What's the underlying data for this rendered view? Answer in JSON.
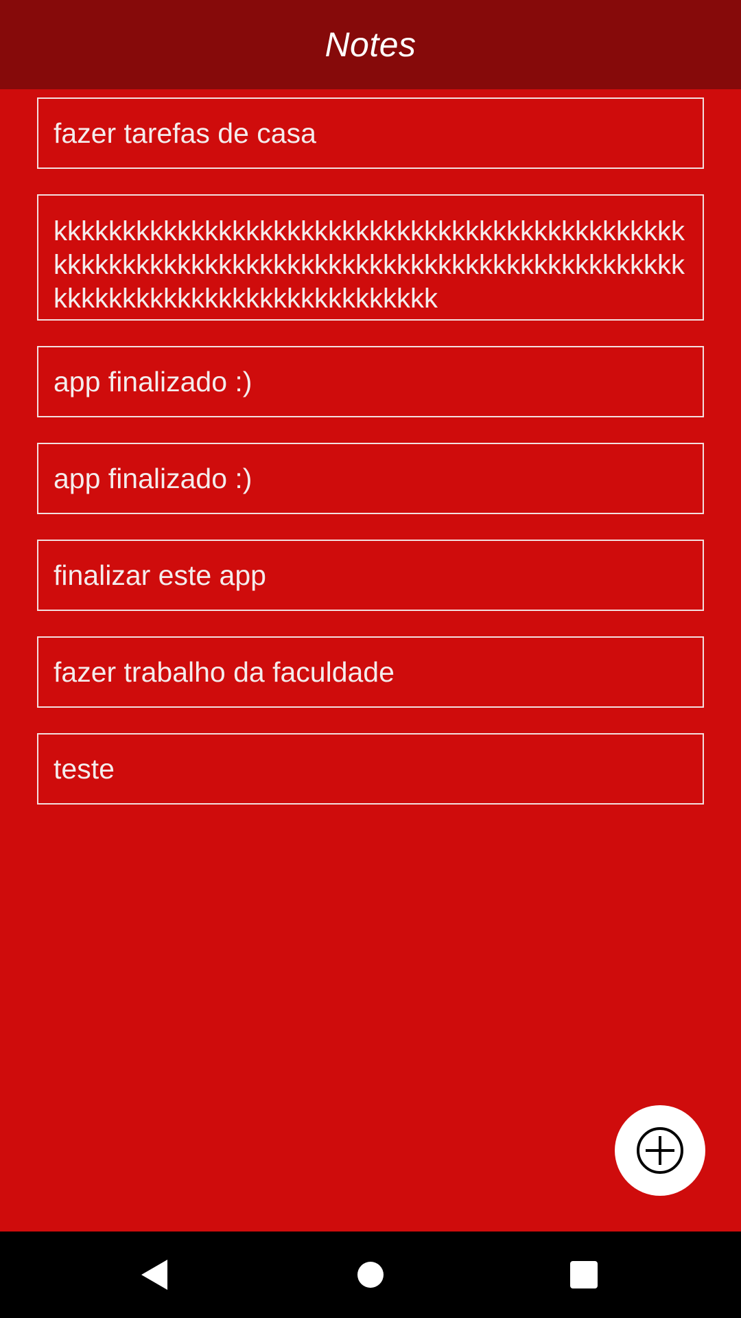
{
  "app_bar": {
    "title": "Notes",
    "background": "#860a0a"
  },
  "theme": {
    "background": "#cf0c0c",
    "note_border": "#f3e0e0",
    "note_text": "#f4ecec"
  },
  "notes": [
    {
      "text": "fazer tarefas de casa"
    },
    {
      "text": "kkkkkkkkkkkkkkkkkkkkkkkkkkkkkkkkkkkkkkkkkkkkkkkkkkkkkkkkkkkkkkkkkkkkkkkkkkkkkkkkkkkkkkkkkkkkkkkkkkkkkkkkkkkkkkkkkkkkkkkk"
    },
    {
      "text": "app finalizado :)"
    },
    {
      "text": "app finalizado :)"
    },
    {
      "text": "finalizar este app"
    },
    {
      "text": "fazer trabalho da faculdade"
    },
    {
      "text": "teste"
    }
  ],
  "fab": {
    "icon": "add-circle-icon"
  },
  "navigation_bar": {
    "back_icon": "back-triangle-icon",
    "home_icon": "home-circle-icon",
    "recents_icon": "recents-square-icon"
  }
}
